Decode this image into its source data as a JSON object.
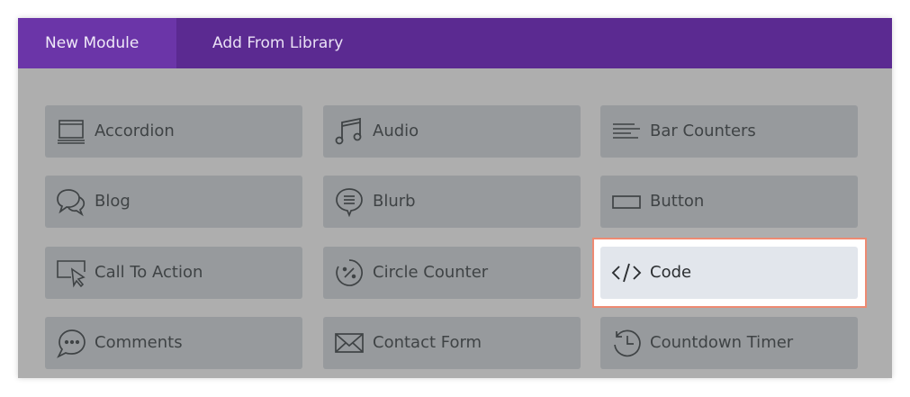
{
  "tabs": [
    {
      "label": "New Module",
      "active": true
    },
    {
      "label": "Add From Library",
      "active": false
    }
  ],
  "colors": {
    "tab_bar": "#5b2a91",
    "active_tab": "#6b35a8",
    "overlay": "#aeaeae",
    "module_bg": "#979a9d",
    "highlight_border": "#ee8a72",
    "highlight_bg": "#e2e6ec"
  },
  "modules": [
    {
      "label": "Accordion",
      "icon": "accordion-icon"
    },
    {
      "label": "Audio",
      "icon": "music-note-icon"
    },
    {
      "label": "Bar Counters",
      "icon": "bar-counters-icon"
    },
    {
      "label": "Blog",
      "icon": "speech-bubbles-icon"
    },
    {
      "label": "Blurb",
      "icon": "blurb-bubble-icon"
    },
    {
      "label": "Button",
      "icon": "button-rectangle-icon"
    },
    {
      "label": "Call To Action",
      "icon": "cursor-screen-icon"
    },
    {
      "label": "Circle Counter",
      "icon": "circle-percent-icon"
    },
    {
      "label": "Code",
      "icon": "code-brackets-icon",
      "highlighted": true
    },
    {
      "label": "Comments",
      "icon": "comment-bubble-icon"
    },
    {
      "label": "Contact Form",
      "icon": "envelope-icon"
    },
    {
      "label": "Countdown Timer",
      "icon": "history-clock-icon"
    }
  ]
}
